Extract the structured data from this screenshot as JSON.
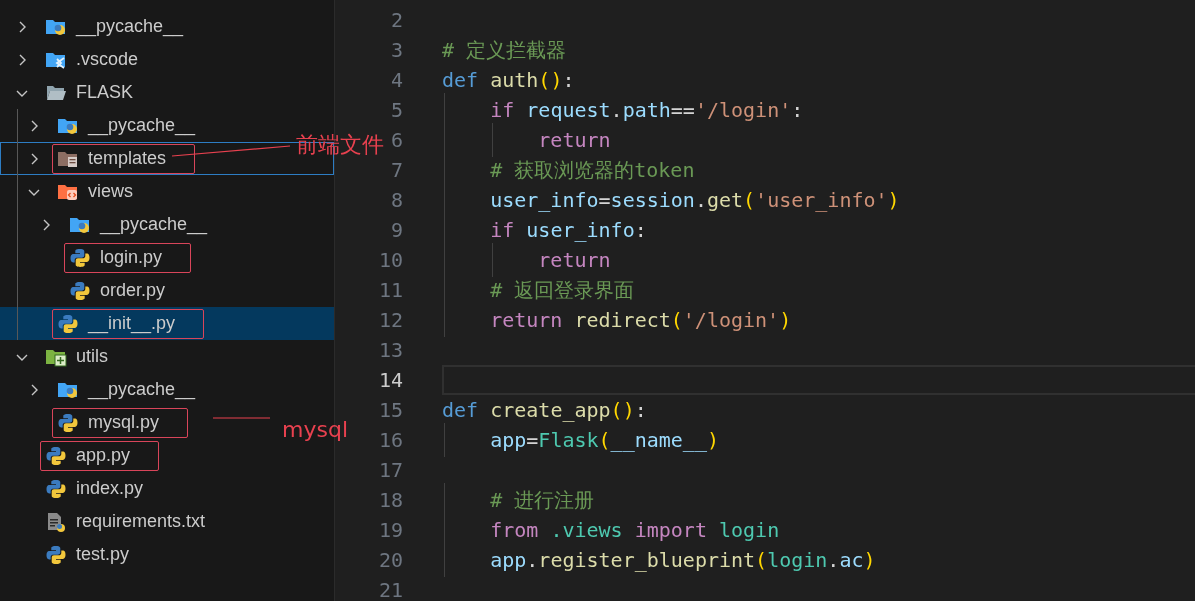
{
  "explorer": {
    "tree": [
      {
        "label": "__pycache__",
        "kind": "python-folder",
        "expanded": false,
        "selected": false,
        "marked": false,
        "focused": false
      },
      {
        "label": ".vscode",
        "kind": "vscode-folder",
        "expanded": false,
        "selected": false,
        "marked": false,
        "focused": false
      },
      {
        "label": "FLASK",
        "kind": "folder",
        "expanded": true,
        "selected": false,
        "marked": false,
        "focused": false,
        "children": [
          {
            "label": "__pycache__",
            "kind": "python-folder",
            "expanded": false,
            "selected": false,
            "marked": false,
            "focused": false
          },
          {
            "label": "templates",
            "kind": "templates-folder",
            "expanded": false,
            "selected": false,
            "marked": true,
            "focused": true
          },
          {
            "label": "views",
            "kind": "views-folder",
            "expanded": true,
            "selected": false,
            "marked": false,
            "focused": false,
            "children": [
              {
                "label": "__pycache__",
                "kind": "python-folder",
                "expanded": false,
                "selected": false,
                "marked": false,
                "focused": false
              },
              {
                "label": "login.py",
                "kind": "python",
                "selected": false,
                "marked": true,
                "focused": false
              },
              {
                "label": "order.py",
                "kind": "python",
                "selected": false,
                "marked": false,
                "focused": false
              }
            ]
          },
          {
            "label": "__init__.py",
            "kind": "python",
            "selected": true,
            "marked": true,
            "focused": false
          }
        ]
      },
      {
        "label": "utils",
        "kind": "utils-folder",
        "expanded": true,
        "selected": false,
        "marked": false,
        "focused": false,
        "children": [
          {
            "label": "__pycache__",
            "kind": "python-folder",
            "expanded": false,
            "selected": false,
            "marked": false,
            "focused": false
          },
          {
            "label": "mysql.py",
            "kind": "python",
            "selected": false,
            "marked": true,
            "focused": false
          }
        ]
      },
      {
        "label": "app.py",
        "kind": "python",
        "selected": false,
        "marked": true,
        "focused": false
      },
      {
        "label": "index.py",
        "kind": "python",
        "selected": false,
        "marked": false,
        "focused": false
      },
      {
        "label": "requirements.txt",
        "kind": "text",
        "selected": false,
        "marked": false,
        "focused": false
      },
      {
        "label": "test.py",
        "kind": "python",
        "selected": false,
        "marked": false,
        "focused": false
      }
    ]
  },
  "annotations": [
    {
      "text": "前端文件"
    },
    {
      "text": "mysql"
    }
  ],
  "editor": {
    "lines": [
      {
        "number": "2",
        "current": false
      },
      {
        "number": "3",
        "current": false,
        "tokens": [
          {
            "text": "# 定义拦截器",
            "kind": "comment"
          }
        ]
      },
      {
        "number": "4",
        "current": false,
        "tokens": [
          {
            "text": "def ",
            "kind": "keyword"
          },
          {
            "text": "auth",
            "kind": "function"
          },
          {
            "text": "()",
            "kind": "bracket"
          },
          {
            "text": ":",
            "kind": "punct"
          }
        ]
      },
      {
        "number": "5",
        "current": false,
        "tokens": [
          {
            "text": "    if ",
            "kind": "control"
          },
          {
            "text": "request",
            "kind": "variable"
          },
          {
            "text": ".",
            "kind": "punct"
          },
          {
            "text": "path",
            "kind": "variable"
          },
          {
            "text": "==",
            "kind": "punct"
          },
          {
            "text": "'/login'",
            "kind": "string"
          },
          {
            "text": ":",
            "kind": "punct"
          }
        ]
      },
      {
        "number": "6",
        "current": false,
        "tokens": [
          {
            "text": "        return",
            "kind": "control"
          }
        ]
      },
      {
        "number": "7",
        "current": false,
        "tokens": [
          {
            "text": "    # 获取浏览器的token",
            "kind": "comment"
          }
        ]
      },
      {
        "number": "8",
        "current": false,
        "tokens": [
          {
            "text": "    user_info",
            "kind": "variable"
          },
          {
            "text": "=",
            "kind": "punct"
          },
          {
            "text": "session",
            "kind": "variable"
          },
          {
            "text": ".",
            "kind": "punct"
          },
          {
            "text": "get",
            "kind": "function"
          },
          {
            "text": "(",
            "kind": "bracket"
          },
          {
            "text": "'user_info'",
            "kind": "string"
          },
          {
            "text": ")",
            "kind": "bracket"
          }
        ]
      },
      {
        "number": "9",
        "current": false,
        "tokens": [
          {
            "text": "    if ",
            "kind": "control"
          },
          {
            "text": "user_info",
            "kind": "variable"
          },
          {
            "text": ":",
            "kind": "punct"
          }
        ]
      },
      {
        "number": "10",
        "current": false,
        "tokens": [
          {
            "text": "        return",
            "kind": "control"
          }
        ]
      },
      {
        "number": "11",
        "current": false,
        "tokens": [
          {
            "text": "    # 返回登录界面",
            "kind": "comment"
          }
        ]
      },
      {
        "number": "12",
        "current": false,
        "tokens": [
          {
            "text": "    return ",
            "kind": "control"
          },
          {
            "text": "redirect",
            "kind": "function"
          },
          {
            "text": "(",
            "kind": "bracket"
          },
          {
            "text": "'/login'",
            "kind": "string"
          },
          {
            "text": ")",
            "kind": "bracket"
          }
        ]
      },
      {
        "number": "13",
        "current": false
      },
      {
        "number": "14",
        "current": true
      },
      {
        "number": "15",
        "current": false,
        "tokens": [
          {
            "text": "def ",
            "kind": "keyword"
          },
          {
            "text": "create_app",
            "kind": "function"
          },
          {
            "text": "()",
            "kind": "bracket"
          },
          {
            "text": ":",
            "kind": "punct"
          }
        ]
      },
      {
        "number": "16",
        "current": false,
        "tokens": [
          {
            "text": "    app",
            "kind": "variable"
          },
          {
            "text": "=",
            "kind": "punct"
          },
          {
            "text": "Flask",
            "kind": "class"
          },
          {
            "text": "(",
            "kind": "bracket"
          },
          {
            "text": "__name__",
            "kind": "variable"
          },
          {
            "text": ")",
            "kind": "bracket"
          }
        ]
      },
      {
        "number": "17",
        "current": false
      },
      {
        "number": "18",
        "current": false,
        "tokens": [
          {
            "text": "    # 进行注册",
            "kind": "comment"
          }
        ]
      },
      {
        "number": "19",
        "current": false,
        "tokens": [
          {
            "text": "    from ",
            "kind": "control"
          },
          {
            "text": ".views ",
            "kind": "class"
          },
          {
            "text": "import ",
            "kind": "control"
          },
          {
            "text": "login",
            "kind": "class"
          }
        ]
      },
      {
        "number": "20",
        "current": false,
        "tokens": [
          {
            "text": "    app",
            "kind": "variable"
          },
          {
            "text": ".",
            "kind": "punct"
          },
          {
            "text": "register_blueprint",
            "kind": "function"
          },
          {
            "text": "(",
            "kind": "bracket"
          },
          {
            "text": "login",
            "kind": "class"
          },
          {
            "text": ".",
            "kind": "punct"
          },
          {
            "text": "ac",
            "kind": "variable"
          },
          {
            "text": ")",
            "kind": "bracket"
          }
        ]
      },
      {
        "number": "21",
        "current": false
      }
    ]
  }
}
